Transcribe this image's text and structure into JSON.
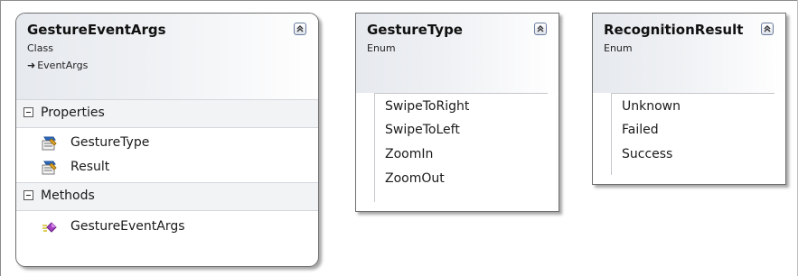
{
  "gesture_event_args": {
    "title": "GestureEventArgs",
    "stereotype": "Class",
    "base_class": "EventArgs",
    "compartments": [
      {
        "label": "Properties",
        "members": [
          {
            "name": "GestureType",
            "icon": "property-icon"
          },
          {
            "name": "Result",
            "icon": "property-icon"
          }
        ]
      },
      {
        "label": "Methods",
        "members": [
          {
            "name": "GestureEventArgs",
            "icon": "method-icon"
          }
        ]
      }
    ]
  },
  "gesture_type": {
    "title": "GestureType",
    "stereotype": "Enum",
    "values": [
      "SwipeToRight",
      "SwipeToLeft",
      "ZoomIn",
      "ZoomOut"
    ]
  },
  "recognition_result": {
    "title": "RecognitionResult",
    "stereotype": "Enum",
    "values": [
      "Unknown",
      "Failed",
      "Success"
    ]
  },
  "colors": {
    "border": "#6f6f6f",
    "header_start": "#e6e9ee",
    "compartment": "#f1f3f5",
    "collapse_border": "#6a7d9b"
  }
}
